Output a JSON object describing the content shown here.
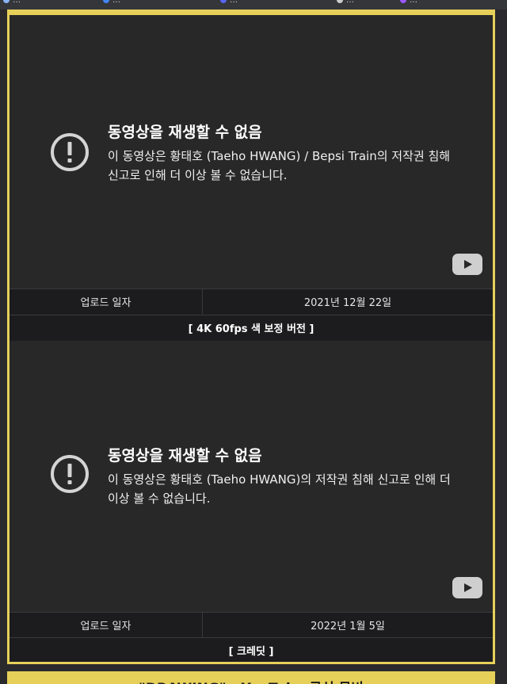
{
  "bookmarks_bar": {
    "items": [
      {
        "label": "…",
        "icon": "bookmark-icon",
        "color": "#8ab4f8"
      },
      {
        "label": "…",
        "icon": "bookmark-icon",
        "color": "#4285f4"
      },
      {
        "label": "…",
        "icon": "bookmark-icon",
        "color": "#5865f2"
      },
      {
        "label": "…",
        "icon": "github-icon",
        "color": "#cccccc"
      },
      {
        "label": "…",
        "icon": "bookmark-icon",
        "color": "#9b59ff"
      }
    ]
  },
  "videos": [
    {
      "error_title": "동영상을 재생할 수 없음",
      "error_message": "이 동영상은 황태호 (Taeho HWANG) / Bepsi Train의 저작권 침해 신고로 인해 더 이상 볼 수 없습니다.",
      "upload_label": "업로드 일자",
      "upload_date": "2021년 12월 22일",
      "caption": "[ 4K 60fps 색 보정 버전 ]"
    },
    {
      "error_title": "동영상을 재생할 수 없음",
      "error_message": "이 동영상은 황태호 (Taeho HWANG)의 저작권 침해 신고로 인해 더 이상 볼 수 없습니다.",
      "upload_label": "업로드 일자",
      "upload_date": "2022년 1월 5일",
      "caption": "[ 크레딧 ]"
    }
  ],
  "next_section_title": "\"DRAWING\" - YouTube 공식 뮤비",
  "colors": {
    "frame_border": "#e6d05a",
    "video_bg": "#282828",
    "row_bg": "#1c1c1e"
  }
}
